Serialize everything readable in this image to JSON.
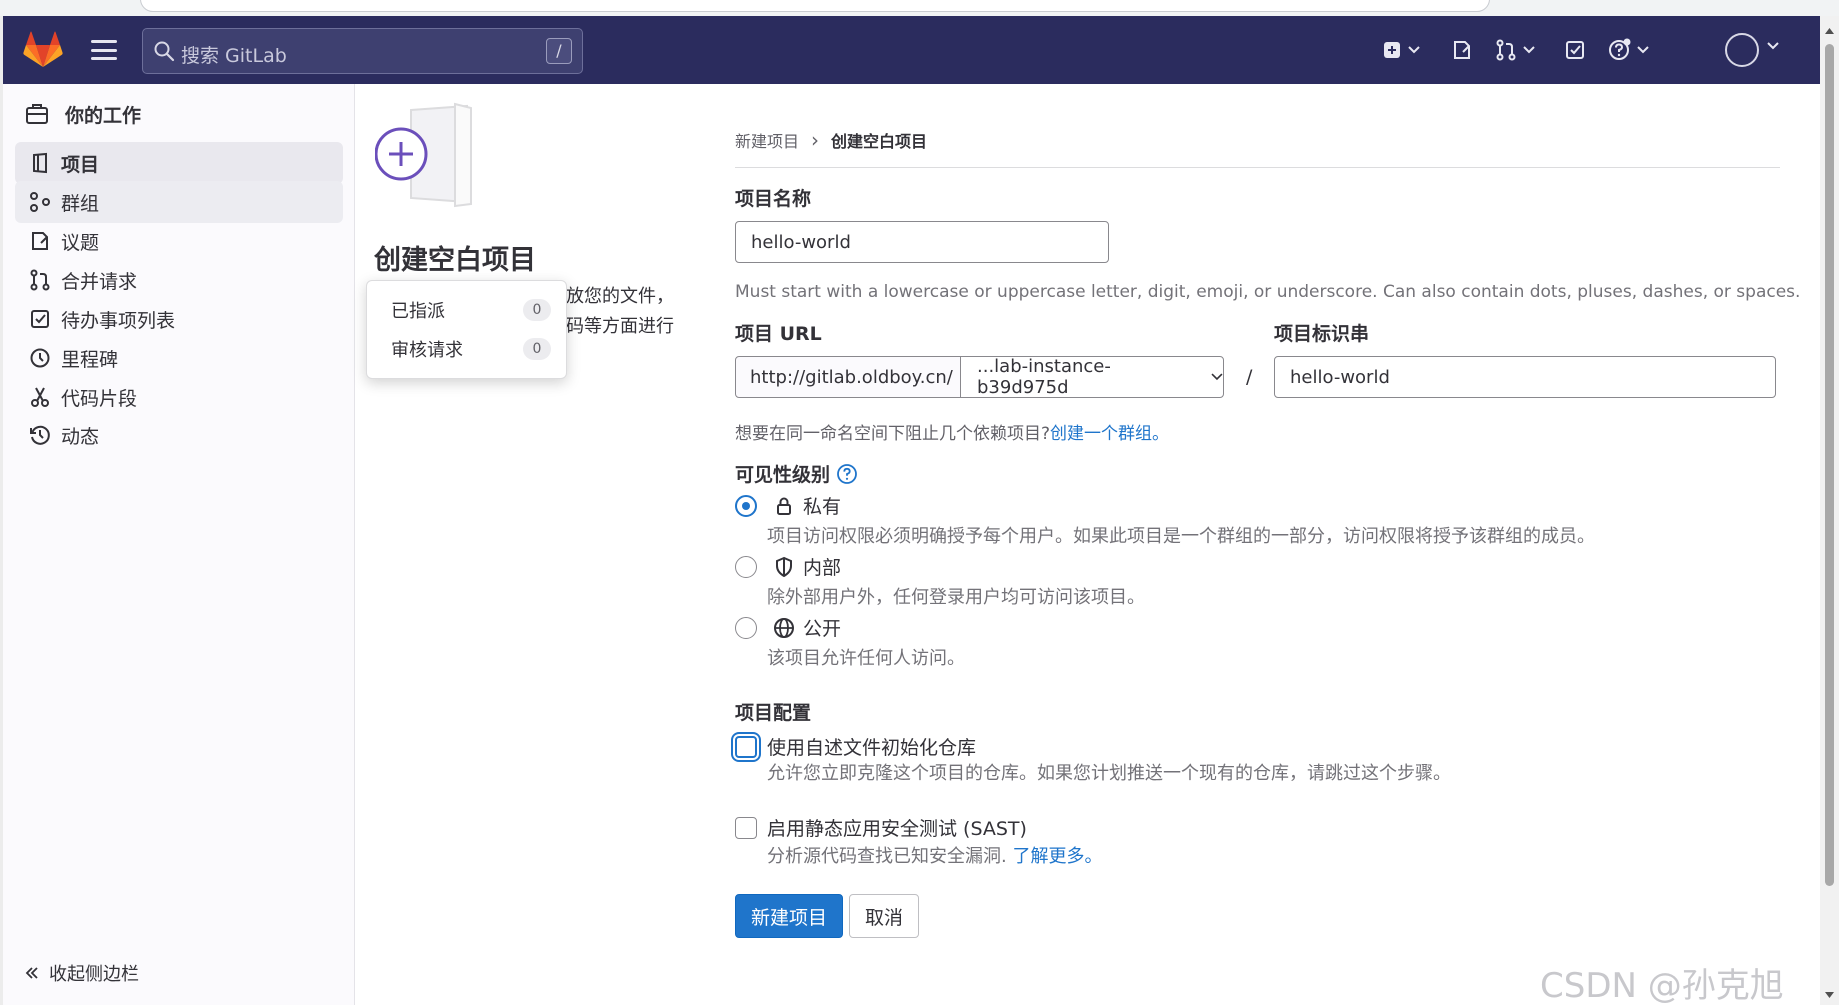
{
  "colors": {
    "header_bg": "#2b2c5e",
    "accent": "#1f75cb",
    "sidebar_bg": "#fbfafd",
    "logo_orange": "#e24329",
    "illustration_purple": "#6b4fbb"
  },
  "header": {
    "search_placeholder": "搜索 GitLab",
    "search_shortcut": "/",
    "icons": [
      "gitlab-logo-icon",
      "hamburger-icon",
      "plus-square-icon",
      "issues-icon",
      "merge-request-icon",
      "todo-icon",
      "help-icon",
      "avatar"
    ]
  },
  "sidebar": {
    "context_title": "你的工作",
    "items": [
      {
        "label": "项目",
        "icon": "project-icon",
        "active": true
      },
      {
        "label": "群组",
        "icon": "group-icon"
      },
      {
        "label": "议题",
        "icon": "issues-icon"
      },
      {
        "label": "合并请求",
        "icon": "merge-request-icon"
      },
      {
        "label": "待办事项列表",
        "icon": "todo-icon"
      },
      {
        "label": "里程碑",
        "icon": "milestone-icon"
      },
      {
        "label": "代码片段",
        "icon": "snippet-icon"
      },
      {
        "label": "动态",
        "icon": "history-icon"
      }
    ],
    "collapse_label": "收起侧边栏"
  },
  "popover": {
    "rows": [
      {
        "label": "已指派",
        "count": "0"
      },
      {
        "label": "审核请求",
        "count": "0"
      }
    ]
  },
  "intro": {
    "title": "创建空白项目",
    "desc_line1": "放您的文件，",
    "desc_line2": "码等方面进行"
  },
  "breadcrumb": {
    "parent": "新建项目",
    "separator": "›",
    "current": "创建空白项目"
  },
  "form": {
    "name_label": "项目名称",
    "name_value": "hello-world",
    "name_help": "Must start with a lowercase or uppercase letter, digit, emoji, or underscore. Can also contain dots, pluses, dashes, or spaces.",
    "url_label": "项目 URL",
    "url_prefix": "http://gitlab.oldboy.cn/",
    "namespace_value": "...lab-instance-b39d975d",
    "url_separator": "/",
    "slug_label": "项目标识串",
    "slug_value": "hello-world",
    "namespace_help": "想要在同一命名空间下阻止几个依赖项目?",
    "namespace_help_link": "创建一个群组。",
    "visibility_label": "可见性级别",
    "visibility_options": [
      {
        "label": "私有",
        "icon": "lock-icon",
        "desc": "项目访问权限必须明确授予每个用户。如果此项目是一个群组的一部分，访问权限将授予该群组的成员。",
        "checked": true
      },
      {
        "label": "内部",
        "icon": "shield-icon",
        "desc": "除外部用户外，任何登录用户均可访问该项目。",
        "checked": false
      },
      {
        "label": "公开",
        "icon": "globe-icon",
        "desc": "该项目允许任何人访问。",
        "checked": false
      }
    ],
    "config_label": "项目配置",
    "readme_label": "使用自述文件初始化仓库",
    "readme_desc": "允许您立即克隆这个项目的仓库。如果您计划推送一个现有的仓库，请跳过这个步骤。",
    "sast_label": "启用静态应用安全测试 (SAST)",
    "sast_desc": "分析源代码查找已知安全漏洞.",
    "sast_link": "了解更多。",
    "submit_label": "新建项目",
    "cancel_label": "取消"
  },
  "watermark": "CSDN @孙克旭"
}
